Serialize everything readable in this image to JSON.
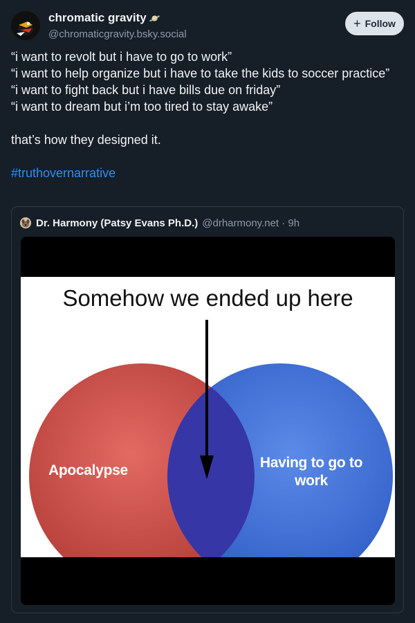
{
  "author": {
    "display_name": "chromatic gravity",
    "name_emoji": "🪐",
    "handle": "@chromaticgravity.bsky.social"
  },
  "follow_button": {
    "icon": "plus-icon",
    "label": "Follow"
  },
  "post": {
    "lines": [
      "“i want to revolt but i have to go to work”",
      "“i want to help organize but i have to take the kids to soccer practice”",
      "“i want to fight back but i have bills due on friday”",
      "“i want to dream but i’m too tired to stay awake”"
    ],
    "closing": "that’s how they designed it.",
    "hashtag": "#truthovernarrative"
  },
  "quote": {
    "author_name": "Dr. Harmony (Patsy Evans Ph.D.)",
    "author_meta": "@drharmony.net · 9h",
    "image": {
      "title": "Somehow we ended up here",
      "left_label": "Apocalypse",
      "right_label": "Having to go to work",
      "colors": {
        "left_circle": "#c9443f",
        "right_circle": "#3f6fd6",
        "overlap": "#3a3aa8"
      }
    }
  }
}
